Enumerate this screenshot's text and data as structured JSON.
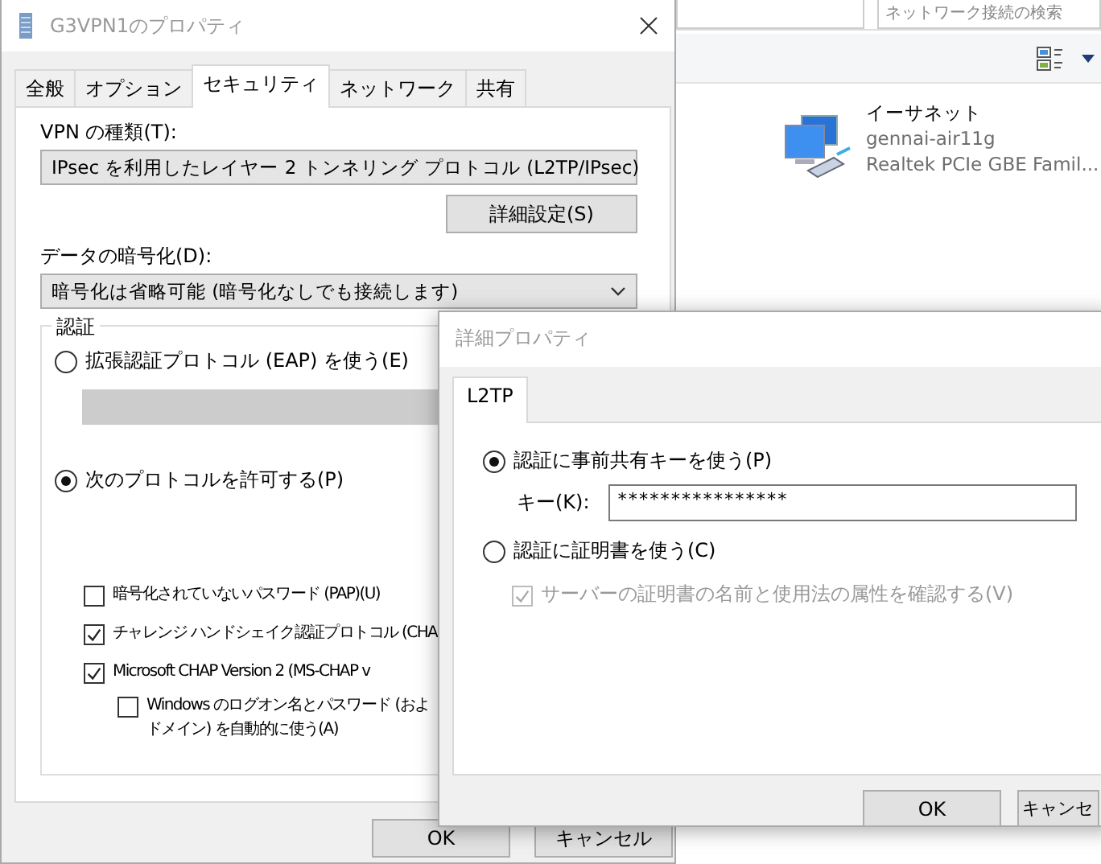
{
  "explorer": {
    "search": {
      "placeholder": "ネットワーク接続の検索"
    },
    "items": [
      {
        "name": "イーサネット",
        "lines": [
          "gennai-air11g",
          "Realtek PCIe GBE Famil..."
        ]
      }
    ]
  },
  "properties_dialog": {
    "title": "G3VPN1のプロパティ",
    "tabs": [
      {
        "label": "全般",
        "selected": false
      },
      {
        "label": "オプション",
        "selected": false
      },
      {
        "label": "セキュリティ",
        "selected": true
      },
      {
        "label": "ネットワーク",
        "selected": false
      },
      {
        "label": "共有",
        "selected": false
      }
    ],
    "vpn_type": {
      "label": "VPN の種類(T):",
      "value": "IPsec を利用したレイヤー 2 トンネリング プロトコル (L2TP/IPsec)"
    },
    "advanced_button": "詳細設定(S)",
    "encryption": {
      "label": "データの暗号化(D):",
      "value": "暗号化は省略可能 (暗号化なしでも接続します)"
    },
    "auth": {
      "title": "認証",
      "options": [
        {
          "label": "拡張認証プロトコル (EAP) を使う(E)",
          "selected": false
        },
        {
          "label": "次のプロトコルを許可する(P)",
          "selected": true
        }
      ],
      "protocols": [
        {
          "lines": [
            "暗号化されていないパスワード (PAP)(U)"
          ],
          "checked": false
        },
        {
          "lines": [
            "チャレンジ ハンドシェイク認証プロトコル (CHA"
          ],
          "checked": true
        },
        {
          "lines": [
            "Microsoft CHAP Version 2 (MS-CHAP v"
          ],
          "checked": true,
          "children": [
            {
              "lines": [
                "Windows のログオン名とパスワード (およ",
                "ドメイン) を自動的に使う(A)"
              ],
              "checked": false
            }
          ]
        }
      ]
    },
    "buttons": [
      "OK",
      "キャンセル"
    ]
  },
  "advanced_dialog": {
    "title": "詳細プロパティ",
    "tabs": [
      {
        "label": "L2TP",
        "selected": true
      }
    ],
    "options": [
      {
        "label": "認証に事前共有キーを使う(P)",
        "selected": true,
        "key": {
          "label": "キー(K):",
          "value": "****************"
        }
      },
      {
        "label": "認証に証明書を使う(C)",
        "selected": false,
        "check": {
          "label": "サーバーの証明書の名前と使用法の属性を確認する(V)",
          "checked": true,
          "disabled": true
        }
      }
    ],
    "buttons": [
      "OK",
      "キャンセ"
    ]
  }
}
